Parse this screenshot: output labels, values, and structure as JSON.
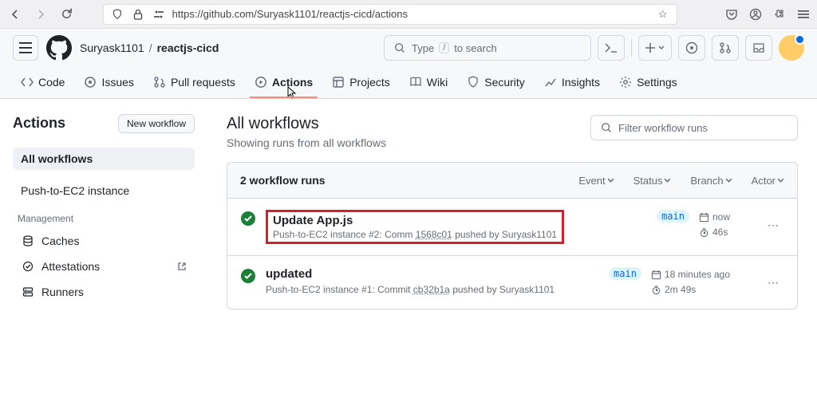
{
  "browser": {
    "url": "https://github.com/Suryask1101/reactjs-cicd/actions"
  },
  "breadcrumb": {
    "owner": "Suryask1101",
    "repo": "reactjs-cicd"
  },
  "search": {
    "label": "Type",
    "kbd": "/",
    "suffix": "to search"
  },
  "repo_tabs": {
    "code": "Code",
    "issues": "Issues",
    "pulls": "Pull requests",
    "actions": "Actions",
    "projects": "Projects",
    "wiki": "Wiki",
    "security": "Security",
    "insights": "Insights",
    "settings": "Settings"
  },
  "sidebar": {
    "title": "Actions",
    "new_workflow": "New workflow",
    "all": "All workflows",
    "wf0": "Push-to-EC2 instance",
    "mgmt_label": "Management",
    "caches": "Caches",
    "attestations": "Attestations",
    "runners": "Runners"
  },
  "main": {
    "title": "All workflows",
    "subtitle": "Showing runs from all workflows",
    "filter_placeholder": "Filter workflow runs",
    "run_count": "2 workflow runs",
    "filters": {
      "event": "Event",
      "status": "Status",
      "branch": "Branch",
      "actor": "Actor"
    }
  },
  "runs": [
    {
      "title": "Update App.js",
      "workflow": "Push-to-EC2 instance",
      "run_no": "#2",
      "commit_prefix": "Comm",
      "sha": "1568c01",
      "pushed_by": "pushed by Suryask1101",
      "branch": "main",
      "rel_time": "now",
      "duration": "46s"
    },
    {
      "title": "updated",
      "workflow": "Push-to-EC2 instance",
      "run_no": "#1",
      "commit_prefix": "Commit",
      "sha": "cb32b1a",
      "pushed_by": "pushed by Suryask1101",
      "branch": "main",
      "rel_time": "18 minutes ago",
      "duration": "2m 49s"
    }
  ]
}
